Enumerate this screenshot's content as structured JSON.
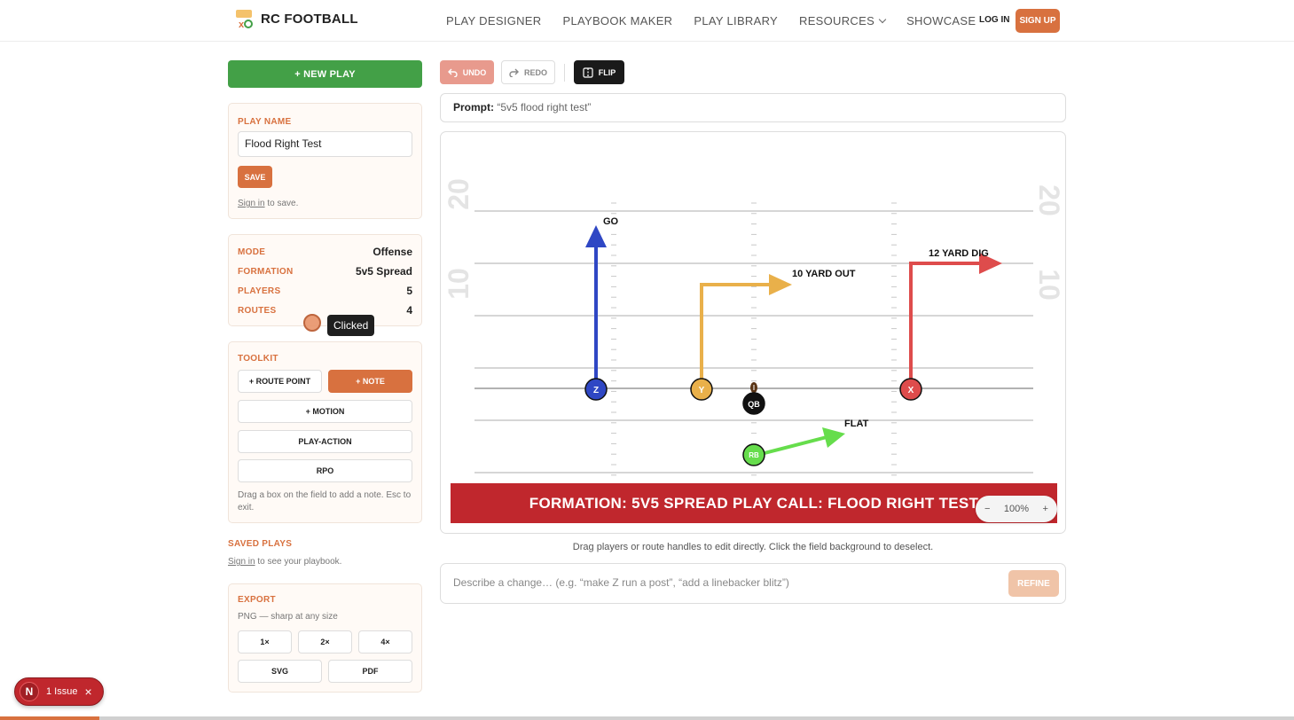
{
  "header": {
    "brand": "RC FOOTBALL",
    "nav": [
      "PLAY DESIGNER",
      "PLAYBOOK MAKER",
      "PLAY LIBRARY",
      "RESOURCES",
      "SHOWCASE"
    ],
    "login": "LOG IN",
    "signup": "SIGN UP"
  },
  "sidebar": {
    "new_play": "+ NEW PLAY",
    "play_name_label": "PLAY NAME",
    "play_name_value": "Flood Right Test",
    "save": "SAVE",
    "sign_in": "Sign in",
    "save_hint": " to save.",
    "stats": [
      {
        "label": "MODE",
        "value": "Offense"
      },
      {
        "label": "FORMATION",
        "value": "5v5 Spread"
      },
      {
        "label": "PLAYERS",
        "value": "5"
      },
      {
        "label": "ROUTES",
        "value": "4"
      }
    ],
    "toolkit_label": "TOOLKIT",
    "tools": {
      "route_point": "+ ROUTE POINT",
      "note": "+ NOTE",
      "motion": "+ MOTION",
      "play_action": "PLAY-ACTION",
      "rpo": "RPO"
    },
    "toolkit_hint": "Drag a box on the field to add a note. Esc to exit.",
    "saved_plays_label": "SAVED PLAYS",
    "saved_hint": " to see your playbook.",
    "export_label": "EXPORT",
    "export_hint": "PNG — sharp at any size",
    "export": {
      "x1": "1×",
      "x2": "2×",
      "x4": "4×",
      "svg": "SVG",
      "pdf": "PDF"
    }
  },
  "tooltip": "Clicked",
  "toolbar": {
    "undo": "UNDO",
    "redo": "REDO",
    "flip": "FLIP"
  },
  "prompt": {
    "label": "Prompt:",
    "value": "“5v5 flood right test”"
  },
  "field": {
    "yard_numbers": {
      "left_20": "20",
      "left_10": "10",
      "right_20": "20",
      "right_10": "10"
    },
    "players": {
      "z": "Z",
      "y": "Y",
      "qb": "QB",
      "x": "X",
      "rb": "RB"
    },
    "routes": {
      "go": "GO",
      "out": "10 YARD OUT",
      "dig": "12 YARD DIG",
      "flat": "FLAT"
    },
    "colors": {
      "z": "#2f47c4",
      "y": "#e9b04a",
      "x": "#de4c4c",
      "rb": "#66dd4c",
      "qb": "#111111"
    },
    "banner": "FORMATION: 5V5 SPREAD PLAY CALL: FLOOD RIGHT TEST",
    "zoom": {
      "minus": "−",
      "level": "100%",
      "plus": "+"
    }
  },
  "drag_hint": "Drag players or route handles to edit directly. Click the field background to deselect.",
  "refine": {
    "placeholder": "Describe a change… (e.g. “make Z run a post”, “add a linebacker blitz”)",
    "button": "REFINE"
  },
  "issue": {
    "n": "N",
    "text": "1 Issue",
    "close": "×"
  }
}
